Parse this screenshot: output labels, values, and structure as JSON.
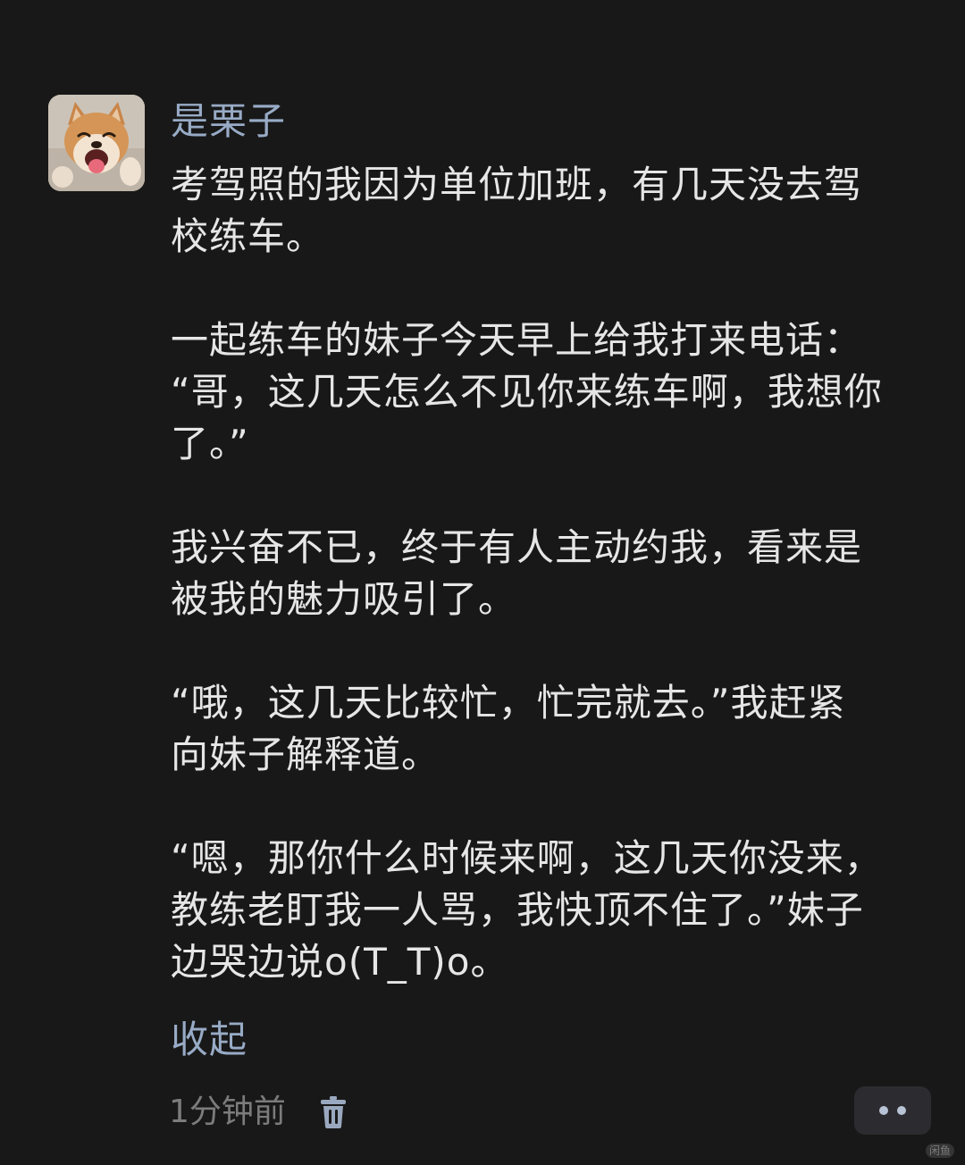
{
  "post": {
    "username": "是栗子",
    "avatar_alt": "",
    "paragraphs": [
      [
        "考驾照的我因为单位加班，有几天没去驾",
        "校练车。"
      ],
      [
        "一起练车的妹子今天早上给我打来电话：",
        "“哥，这几天怎么不见你来练车啊，我想你",
        "了。”"
      ],
      [
        "我兴奋不已，终于有人主动约我，看来是",
        "被我的魅力吸引了。"
      ],
      [
        "“哦，这几天比较忙，忙完就去。”我赶紧",
        "向妹子解释道。"
      ],
      [
        "“嗯，那你什么时候来啊，这几天你没来，",
        "教练老盯我一人骂，我快顶不住了。”妹子",
        "边哭边说o(T_T)o。"
      ]
    ],
    "collapse_label": "收起",
    "timestamp": "1分钟前",
    "delete_icon": "trash-icon",
    "more_icon": "more-dots-icon"
  },
  "watermark": "闲鱼",
  "colors": {
    "background": "#181818",
    "text": "#e6e6e6",
    "accent": "#98abc6",
    "muted": "#7c7c7c",
    "button_bg": "#2c2c30"
  }
}
